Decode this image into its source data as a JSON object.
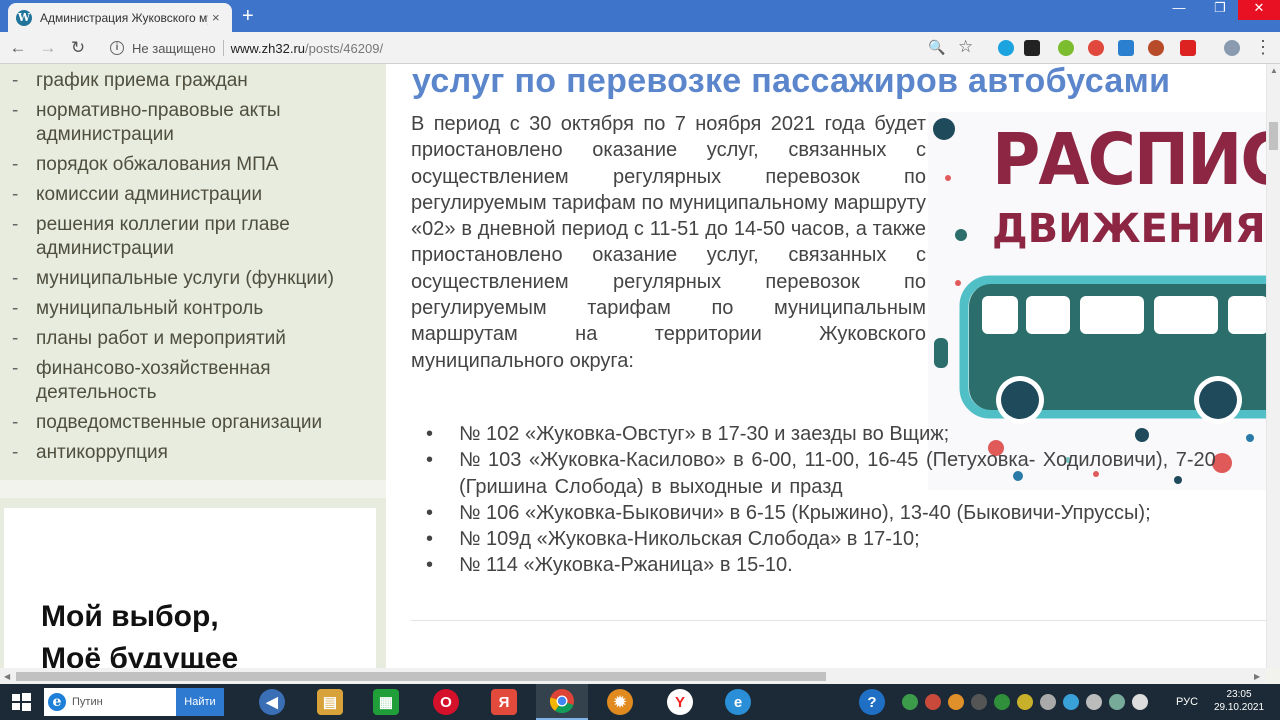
{
  "browser": {
    "tab_title": "Администрация Жуковского му",
    "tab_close": "×",
    "new_tab": "+",
    "window_min": "—",
    "window_max": "❐",
    "window_close": "✕",
    "security_label": "Не защищено",
    "url_host": "www.zh32.ru",
    "url_path": "/posts/46209/",
    "nav_back": "←",
    "nav_forward": "→",
    "nav_reload": "↻",
    "zoom_glyph": "🔍",
    "star_glyph": "☆",
    "menu_glyph": "⋮"
  },
  "sidebar": {
    "menu_items": [
      {
        "dash": "-",
        "label": "график приема граждан"
      },
      {
        "dash": "-",
        "label": "нормативно-правовые акты администрации"
      },
      {
        "dash": "-",
        "label": "порядок обжалования МПА"
      },
      {
        "dash": "-",
        "label": "комиссии администрации"
      },
      {
        "dash": "-",
        "label": "решения коллегии при главе администрации"
      },
      {
        "dash": "-",
        "label": "муниципальные услуги (функции)"
      },
      {
        "dash": "-",
        "label": "муниципальный контроль"
      },
      {
        "dash": "-",
        "label": "планы работ и мероприятий"
      },
      {
        "dash": "-",
        "label": "финансово-хозяйственная деятельность"
      },
      {
        "dash": "-",
        "label": "подведомственные организации"
      },
      {
        "dash": "-",
        "label": "антикоррупция"
      }
    ],
    "banner": {
      "line1": "Мой выбор,",
      "line2": "Моё будущее"
    }
  },
  "article": {
    "heading": "услуг по перевозке пассажиров автобусами",
    "paragraph": "В период с 30 октября по 7 ноября 2021 года будет приостановлено оказание услуг, связанных с осуществлением регулярных перевозок по регулируемым тарифам по муниципальному маршруту «02» в дневной период с 11-51 до 14-50 часов, а также приостановлено оказание услуг, связанных с осуществлением регулярных перевозок по регулируемым тарифам по муниципальным маршрутам на территории Жуковского муниципального округа:",
    "routes": [
      "№ 102 «Жуковка-Овстуг»  в 17-30  и заезды во Вщиж;",
      " №  103  «Жуковка-Касилово»  в  6-00,  11-00, 16-45 (Петуховка- Ходиловичи), 7-20 (Гришина Слобода) в выходные и празд",
      "№ 106 «Жуковка-Быковичи» в 6-15 (Крыжино), 13-40 (Быковичи-Упруссы);",
      "№ 109д «Жуковка-Никольская Слобода» в 17-10;",
      "№ 114 «Жуковка-Ржаница» в 15-10."
    ],
    "image": {
      "title_line1": "РАСПИСА",
      "title_line2": "ДВИЖЕНИЯ АВ"
    }
  },
  "taskbar": {
    "search_value": "Путин",
    "search_button": "Найти",
    "language": "РУС",
    "time": "23:05",
    "date": "29.10.2021"
  },
  "colors": {
    "heading": "#5b86cc",
    "sidebar_bg": "#e8ecde",
    "image_title": "#8c2643",
    "bus": "#2b6e6b",
    "bus_outline": "#51bfc6",
    "tabbar": "#3e74c9",
    "taskbar": "#1b2a36"
  }
}
